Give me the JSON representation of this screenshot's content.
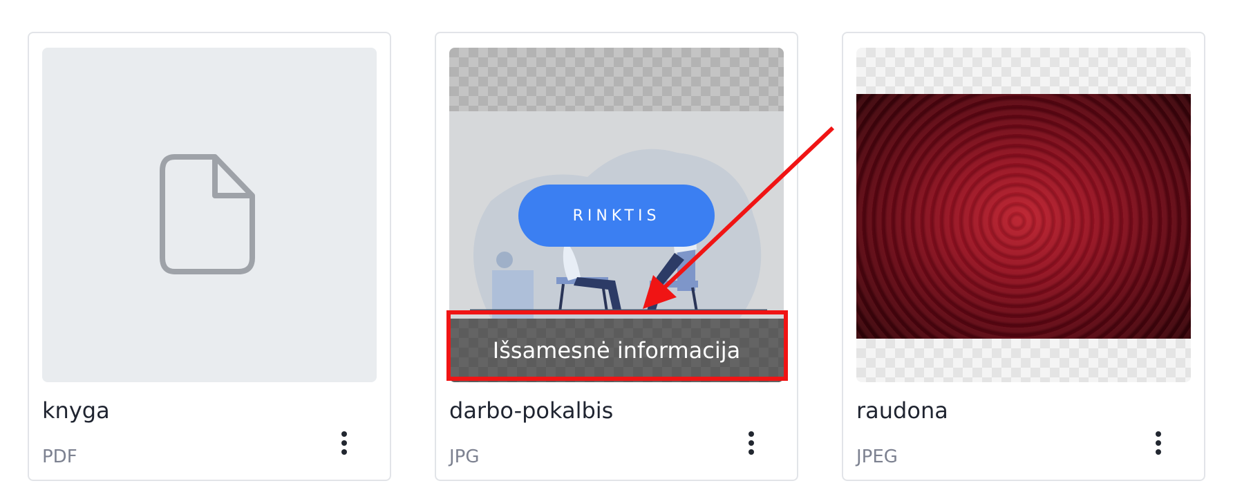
{
  "files": [
    {
      "title": "knyga",
      "type": "PDF",
      "thumbnail": "generic-file-icon"
    },
    {
      "title": "darbo-pokalbis",
      "type": "JPG",
      "thumbnail": "job-interview-illustration",
      "hover": {
        "select_label": "RINKTIS",
        "details_label": "Išsamesnė informacija"
      }
    },
    {
      "title": "raudona",
      "type": "JPEG",
      "thumbnail": "red-damask-texture"
    }
  ],
  "colors": {
    "accent": "#3b7ff2",
    "highlight": "#f01414",
    "title_text": "#1f2430",
    "type_text": "#7c8190"
  },
  "icons": {
    "more": "more-vertical-icon",
    "file": "file-icon"
  }
}
